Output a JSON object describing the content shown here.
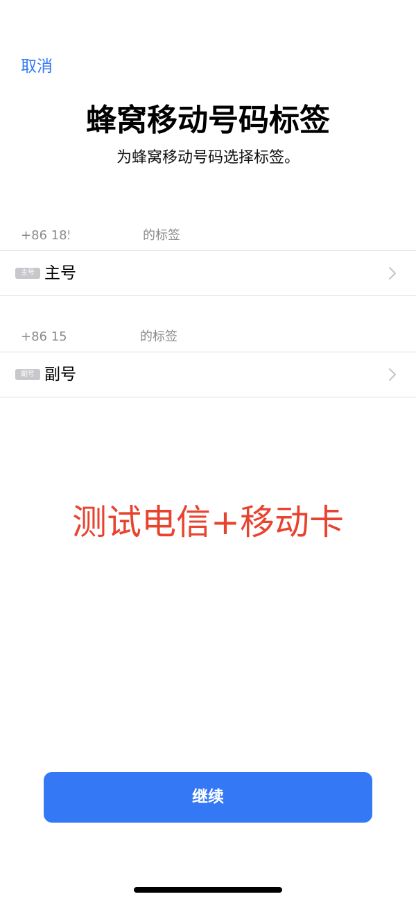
{
  "header": {
    "cancel_label": "取消",
    "title": "蜂窝移动号码标签",
    "subtitle": "为蜂窝移动号码选择标签。"
  },
  "lines": [
    {
      "number": "+86 185",
      "header_suffix": "的标签",
      "badge": "主号",
      "label": "主号"
    },
    {
      "number": "+86 158",
      "header_suffix": "的标签",
      "badge": "副号",
      "label": "副号"
    }
  ],
  "annotation": {
    "text": "测试电信+移动卡",
    "color": "#e8432f"
  },
  "footer": {
    "continue_label": "继续"
  },
  "colors": {
    "accent": "#3478f6",
    "badge_bg": "#c7c7cc",
    "secondary_text": "#8a8a8e"
  },
  "icons": {
    "row_disclosure": "chevron-right-icon"
  }
}
